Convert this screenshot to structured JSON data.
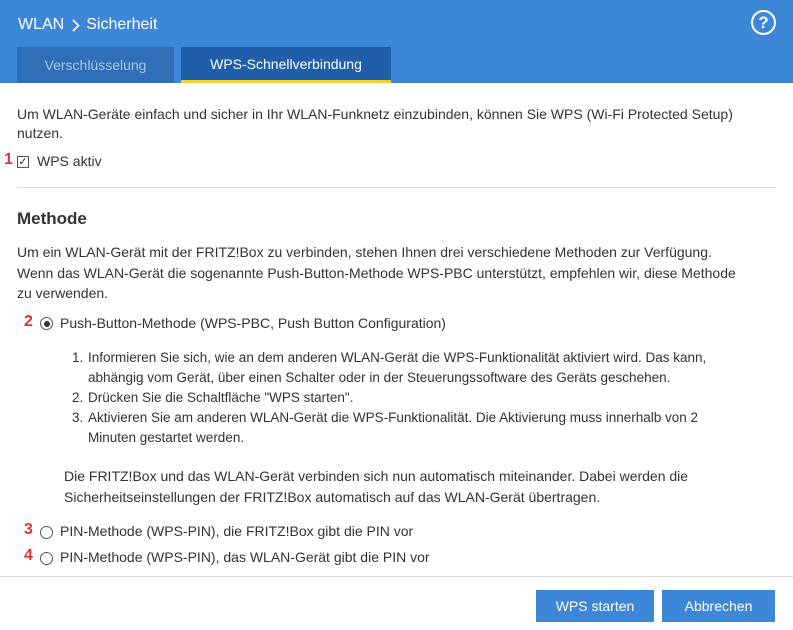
{
  "header": {
    "breadcrumb_root": "WLAN",
    "breadcrumb_current": "Sicherheit",
    "help_label": "?",
    "colors": {
      "header_bg": "#3d87d8",
      "active_tab_underline": "#f2d22e",
      "marker_red": "#e03232"
    }
  },
  "tabs": [
    {
      "label": "Verschlüsselung",
      "active": false
    },
    {
      "label": "WPS-Schnellverbindung",
      "active": true
    }
  ],
  "intro": {
    "line1": "Um WLAN-Geräte einfach und sicher in Ihr WLAN-Funknetz einzubinden, können Sie WPS (Wi-Fi Protected Setup)",
    "line2": "nutzen."
  },
  "wps_active": {
    "marker": "1",
    "label": "WPS aktiv",
    "checked": true
  },
  "method": {
    "heading": "Methode",
    "desc_line1": "Um ein WLAN-Gerät mit der FRITZ!Box zu verbinden, stehen Ihnen drei verschiedene Methoden zur Verfügung.",
    "desc_line2": "Wenn das WLAN-Gerät die sogenannte Push-Button-Methode WPS-PBC unterstützt, empfehlen wir, diese Methode",
    "desc_line3": "zu verwenden.",
    "options": [
      {
        "marker": "2",
        "label": "Push-Button-Methode (WPS-PBC, Push Button Configuration)",
        "selected": true
      },
      {
        "marker": "3",
        "label": "PIN-Methode (WPS-PIN), die FRITZ!Box gibt die PIN vor",
        "selected": false
      },
      {
        "marker": "4",
        "label": "PIN-Methode (WPS-PIN), das WLAN-Gerät gibt die PIN vor",
        "selected": false
      }
    ],
    "steps": [
      {
        "num": "1.",
        "line1": "Informieren Sie sich, wie an dem anderen WLAN-Gerät die WPS-Funktionalität aktiviert wird. Das kann,",
        "line2": "abhängig vom Gerät, über einen Schalter oder in der Steuerungssoftware des Geräts geschehen."
      },
      {
        "num": "2.",
        "line1": "Drücken Sie die Schaltfläche \"WPS starten\".",
        "line2": ""
      },
      {
        "num": "3.",
        "line1": "Aktivieren Sie am anderen WLAN-Gerät die WPS-Funktionalität. Die Aktivierung muss innerhalb von 2",
        "line2": "Minuten gestartet werden."
      }
    ],
    "note_line1": "Die FRITZ!Box und das WLAN-Gerät verbinden sich nun automatisch miteinander. Dabei werden die",
    "note_line2": "Sicherheitseinstellungen der FRITZ!Box automatisch auf das WLAN-Gerät übertragen."
  },
  "buttons": {
    "wps_start": "WPS starten",
    "cancel": "Abbrechen"
  }
}
